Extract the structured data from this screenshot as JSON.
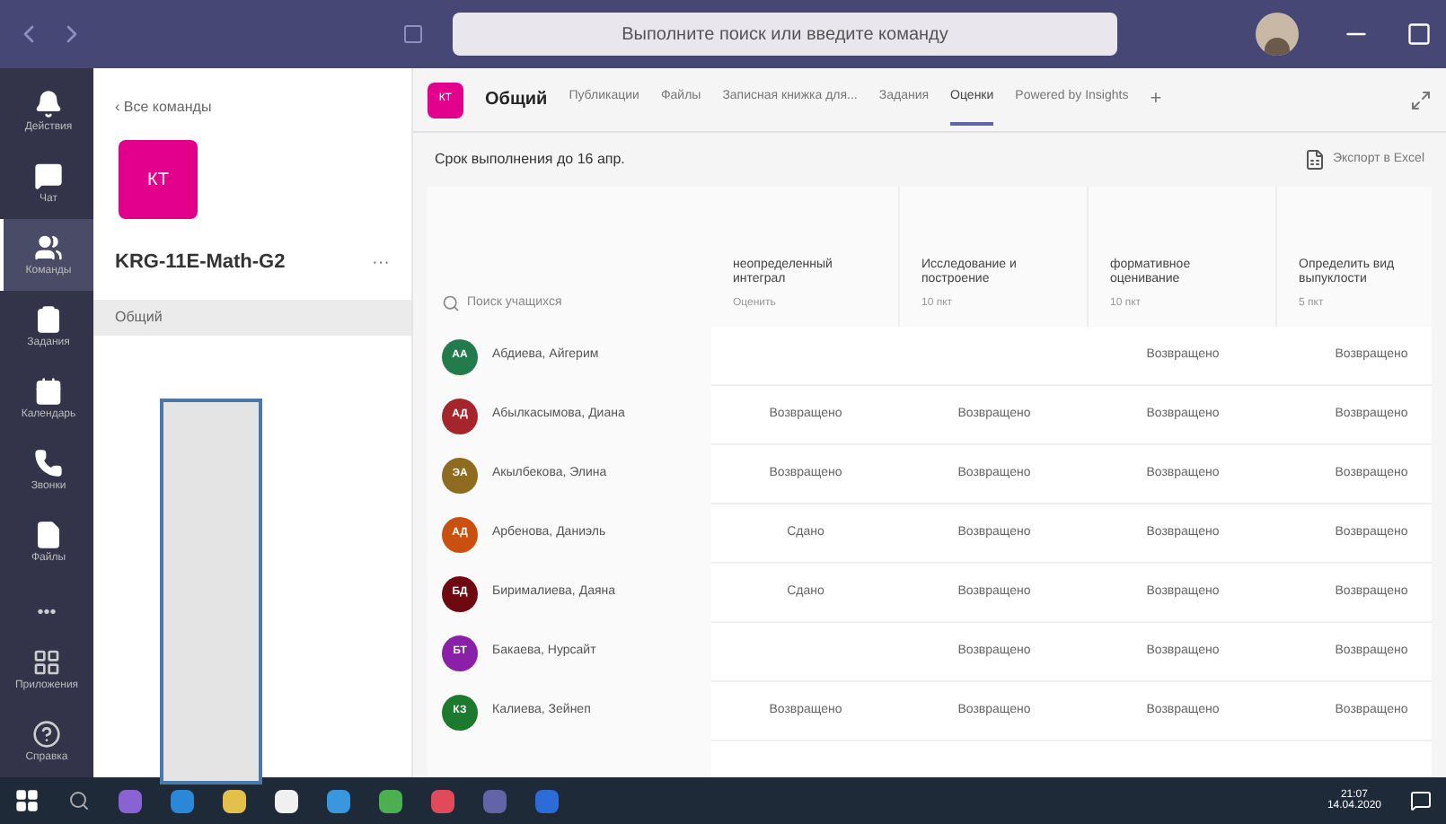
{
  "title_bar": {
    "search_placeholder": "Выполните поиск или введите команду"
  },
  "rail": [
    {
      "label": "Действия",
      "selected": false
    },
    {
      "label": "Чат",
      "selected": false
    },
    {
      "label": "Команды",
      "selected": true
    },
    {
      "label": "Задания",
      "selected": false
    },
    {
      "label": "Календарь",
      "selected": false
    },
    {
      "label": "Звонки",
      "selected": false
    },
    {
      "label": "Файлы",
      "selected": false
    }
  ],
  "rail_more": "•••",
  "rail_bottom": [
    {
      "label": "Приложения"
    },
    {
      "label": "Справка"
    }
  ],
  "team_panel": {
    "back": "‹ Все команды",
    "initials": "КТ",
    "name": "KRG-11E-Math-G2",
    "more": "···",
    "channels": [
      {
        "label": "Общий",
        "selected": true
      }
    ]
  },
  "channel": {
    "initials": "КТ",
    "name": "Общий",
    "tabs": [
      {
        "label": "Публикации",
        "selected": false
      },
      {
        "label": "Файлы",
        "selected": false
      },
      {
        "label": "Записная книжка для...",
        "selected": false
      },
      {
        "label": "Задания",
        "selected": false
      },
      {
        "label": "Оценки",
        "selected": true
      },
      {
        "label": "Powered by Insights",
        "selected": false
      }
    ],
    "add": "+"
  },
  "grades": {
    "due": "Срок выполнения до 16 апр.",
    "export": "Экспорт в Excel",
    "search_placeholder": "Поиск учащихся",
    "columns": [
      {
        "title": "неопределенный интеграл",
        "points": "Оценить"
      },
      {
        "title": "Исследование и построение",
        "points": "10 пкт"
      },
      {
        "title": "формативное оценивание",
        "points": "10 пкт"
      },
      {
        "title": "Определить вид выпуклости",
        "points": "5 пкт"
      }
    ],
    "rows": [
      {
        "initials": "АА",
        "color": "#237b4b",
        "name": "Абдиева, Айгерим",
        "cells": [
          "",
          "",
          "Возвращено",
          "Возвращено"
        ]
      },
      {
        "initials": "АД",
        "color": "#a4262c",
        "name": "Абылкасымова, Диана",
        "cells": [
          "Возвращено",
          "Возвращено",
          "Возвращено",
          "Возвращено"
        ]
      },
      {
        "initials": "ЭА",
        "color": "#8f6b1f",
        "name": "Акылбекова, Элина",
        "cells": [
          "Возвращено",
          "Возвращено",
          "Возвращено",
          "Возвращено"
        ]
      },
      {
        "initials": "АД",
        "color": "#ca5010",
        "name": "Арбенова, Даниэль",
        "cells": [
          "Сдано",
          "Возвращено",
          "Возвращено",
          "Возвращено"
        ]
      },
      {
        "initials": "БД",
        "color": "#6e0811",
        "name": "Бирималиева, Даяна",
        "cells": [
          "Сдано",
          "Возвращено",
          "Возвращено",
          "Возвращено"
        ]
      },
      {
        "initials": "БТ",
        "color": "#8a1fa8",
        "name": "Бакаева, Нурсайт",
        "cells": [
          "",
          "Возвращено",
          "Возвращено",
          "Возвращено"
        ]
      },
      {
        "initials": "КЗ",
        "color": "#1c7a2e",
        "name": "Калиева, Зейнеп",
        "cells": [
          "Возвращено",
          "Возвращено",
          "Возвращено",
          "Возвращено"
        ]
      }
    ]
  },
  "taskbar": {
    "time": "21:07",
    "date": "14.04.2020",
    "apps": [
      {
        "color": "#8a63d2"
      },
      {
        "color": "#2b88d8"
      },
      {
        "color": "#e3c04a"
      },
      {
        "color": "#f0f0f0"
      },
      {
        "color": "#3a96dd"
      },
      {
        "color": "#4caf50"
      },
      {
        "color": "#e04a5a"
      },
      {
        "color": "#6264a7"
      },
      {
        "color": "#2b6cd8"
      }
    ]
  }
}
